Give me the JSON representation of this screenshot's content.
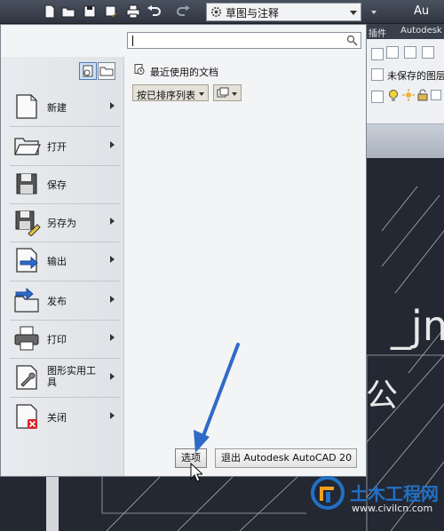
{
  "titlebar": {
    "workspace_label": "草图与注释",
    "title_partial": "Au",
    "icons": [
      "new-icon",
      "open-icon",
      "save-icon",
      "save-as-icon",
      "plot-icon",
      "undo-icon",
      "redo-icon",
      "gear-icon"
    ]
  },
  "ribbon": {
    "tab_plugins": "插件",
    "tab_autodesk": "Autodesk",
    "unsaved_label": "未保存的图层"
  },
  "menu": {
    "search_placeholder": "",
    "items": [
      {
        "label": "新建",
        "icon": "new-document-icon",
        "submenu": true
      },
      {
        "label": "打开",
        "icon": "open-folder-icon",
        "submenu": true
      },
      {
        "label": "保存",
        "icon": "save-icon",
        "submenu": false
      },
      {
        "label": "另存为",
        "icon": "save-as-icon",
        "submenu": true
      },
      {
        "label": "输出",
        "icon": "export-icon",
        "submenu": true
      },
      {
        "label": "发布",
        "icon": "publish-icon",
        "submenu": true
      },
      {
        "label": "打印",
        "icon": "printer-icon",
        "submenu": true
      },
      {
        "label": "图形实用工具",
        "icon": "drawing-utilities-icon",
        "submenu": true
      },
      {
        "label": "关闭",
        "icon": "close-document-icon",
        "submenu": true
      }
    ],
    "recent_documents_label": "最近使用的文档",
    "sort_label": "按已排序列表",
    "options_button": "选项",
    "exit_button": "退出 Autodesk AutoCAD 20"
  },
  "canvas": {
    "text_large": "_jm",
    "text_cjk": "公"
  },
  "watermark": {
    "title": "土木工程网",
    "url": "www.civilcn.com"
  },
  "colors": {
    "accent_blue": "#2f6ac8",
    "app_red": "#c8261c",
    "canvas_bg": "#232833"
  }
}
